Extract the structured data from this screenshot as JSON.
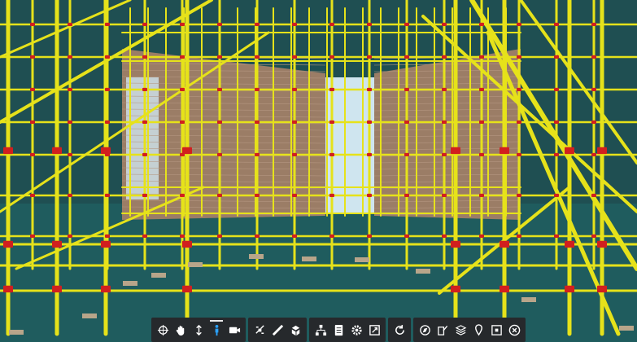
{
  "viewer": {
    "colors": {
      "scaffold": "#e6e21a",
      "coupler": "#d11f1f",
      "floor": "#1f5c5e",
      "wall": "#9b7d66",
      "sky": "#cfe5ef",
      "toolbar_bg": "#26292c",
      "icon": "#ffffff",
      "active_icon": "#2ba3ff"
    }
  },
  "toolbar": {
    "groups": [
      {
        "items": [
          {
            "icon": "orbit-icon",
            "active": false
          },
          {
            "icon": "pan-hand-icon",
            "active": false
          },
          {
            "icon": "zoom-updown-icon",
            "active": false
          },
          {
            "icon": "walk-person-icon",
            "active": true
          },
          {
            "icon": "camera-icon",
            "active": false
          }
        ]
      },
      {
        "items": [
          {
            "icon": "explode-icon",
            "active": false
          },
          {
            "icon": "measure-ruler-icon",
            "active": false
          },
          {
            "icon": "section-box-icon",
            "active": false
          }
        ]
      },
      {
        "items": [
          {
            "icon": "model-tree-icon",
            "active": false
          },
          {
            "icon": "properties-icon",
            "active": false
          },
          {
            "icon": "settings-gear-icon",
            "active": false
          },
          {
            "icon": "fullscreen-icon",
            "active": false
          }
        ]
      },
      {
        "items": [
          {
            "icon": "reset-view-icon",
            "active": false
          }
        ]
      },
      {
        "items": [
          {
            "icon": "compass-icon",
            "active": false
          },
          {
            "icon": "markup-icon",
            "active": false
          },
          {
            "icon": "layers-icon",
            "active": false
          },
          {
            "icon": "location-pin-icon",
            "active": false
          },
          {
            "icon": "share-icon",
            "active": false
          },
          {
            "icon": "close-circle-icon",
            "active": false
          }
        ]
      }
    ]
  }
}
